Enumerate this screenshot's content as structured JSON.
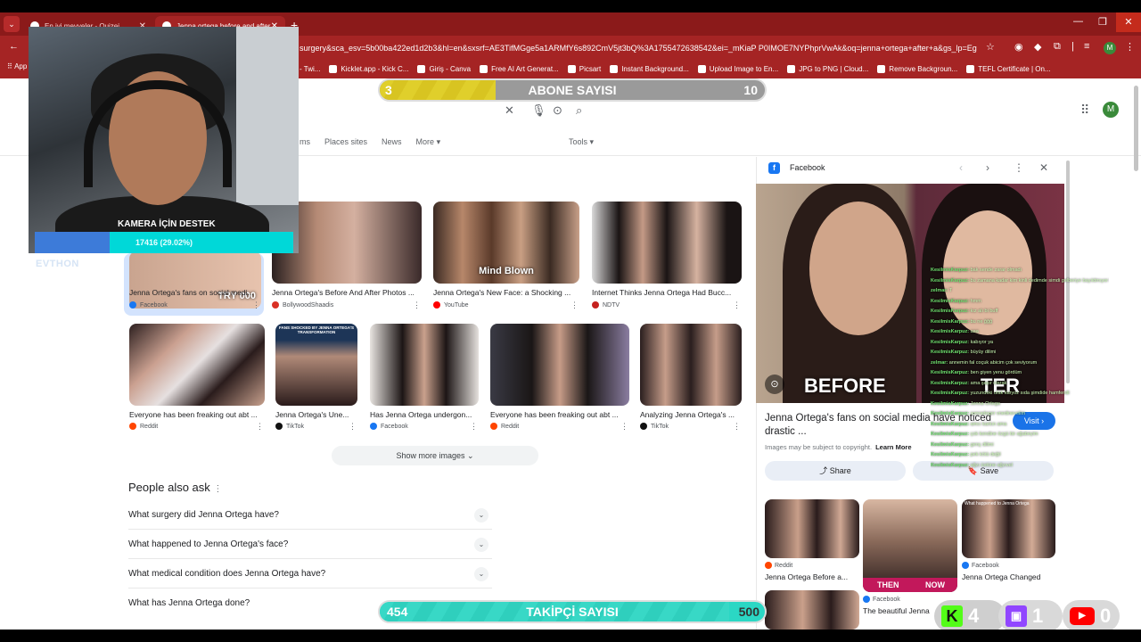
{
  "browser": {
    "tabs": [
      {
        "title": "En iyi meyveler - Quizei",
        "active": false
      },
      {
        "title": "Jenna ortega before and after s",
        "active": true
      }
    ],
    "url": "surgery&sca_esv=5b00ba422ed1d2b3&hl=en&sxsrf=AE3TifMGge5a1ARMfY6s892CmV5jt3bQ%3A1755472638542&ei=_mKiaP P0IMOE7NYPhprVwAk&oq=jenna+ortega+after+a&gs_lp=Egxnd...",
    "profile_initial": "M",
    "bookmarks_prefix": "App",
    "bookmarks": [
      "- Twi...",
      "Kicklet.app - Kick C...",
      "Giriş - Canva",
      "Free AI Art Generat...",
      "Picsart",
      "Instant Background...",
      "Upload Image to En...",
      "JPG to PNG | Cloud...",
      "Remove Backgroun...",
      "TEFL Certificate | On..."
    ]
  },
  "webcam": {
    "label": "KAMERA İÇİN DESTEK",
    "progress_text": "17416 (29.02%)",
    "progress_fraction": 0.29,
    "subtext": "EVTHON"
  },
  "subs_bar": {
    "left": "3",
    "title": "ABONE SAYISI",
    "right": "10",
    "fraction": 0.3
  },
  "follow_bar": {
    "left": "454",
    "title": "TAKİPÇİ SAYISI",
    "right": "500",
    "fraction": 0.908
  },
  "search": {
    "filters": [
      "ms",
      "Places sites",
      "News",
      "More"
    ],
    "tools": "Tools"
  },
  "images_row1": [
    {
      "caption": "Jenna Ortega's fans on social medi...",
      "source": "Facebook",
      "overlay": "TRY 000",
      "color": "#1877f2"
    },
    {
      "caption": "Jenna Ortega's Before And After Photos ...",
      "source": "BollywoodShaadis",
      "color": "#d93025"
    },
    {
      "caption": "Jenna Ortega's New Face: a Shocking ...",
      "source": "YouTube",
      "overlay": "Mind Blown",
      "color": "#ff0000"
    },
    {
      "caption": "Internet Thinks Jenna Ortega Had Bucc...",
      "source": "NDTV",
      "color": "#c5221f"
    }
  ],
  "images_row2": [
    {
      "caption": "Everyone has been freaking out abt ...",
      "source": "Reddit",
      "color": "#ff4500"
    },
    {
      "caption": "Jenna Ortega's Une...",
      "source": "TikTok",
      "overlay": "FANS SHOCKED BY JENNA ORTEGA'S TRANSFORMATION",
      "color": "#111111"
    },
    {
      "caption": "Has Jenna Ortega undergon...",
      "source": "Facebook",
      "color": "#1877f2"
    },
    {
      "caption": "Everyone has been freaking out abt ...",
      "source": "Reddit",
      "color": "#ff4500"
    },
    {
      "caption": "Analyzing Jenna Ortega's ...",
      "source": "TikTok",
      "color": "#111111"
    }
  ],
  "show_more": "Show more images",
  "paa": {
    "title": "People also ask",
    "questions": [
      "What surgery did Jenna Ortega have?",
      "What happened to Jenna Ortega's face?",
      "What medical condition does Jenna Ortega have?",
      "What has Jenna Ortega done?"
    ]
  },
  "panel": {
    "source": "Facebook",
    "hero_label_left": "BEFORE",
    "hero_label_right": "TER",
    "title": "Jenna Ortega's fans on social media have noticed drastic ...",
    "visit": "Visit",
    "copyright": "Images may be subject to copyright.",
    "learn_more": "Learn More",
    "share": "Share",
    "save": "Save",
    "related": [
      {
        "source": "Reddit",
        "caption": "Jenna Ortega Before a...",
        "color": "#ff4500"
      },
      {
        "source": "",
        "caption": "",
        "then": "THEN",
        "now": "NOW",
        "color": "#888888"
      },
      {
        "source": "Facebook",
        "caption": "Jenna Ortega Changed",
        "overlay": "What happened to Jenna Ortega",
        "color": "#1877f2"
      }
    ],
    "related_row2": {
      "source": "Facebook",
      "caption": "The beautiful Jenna"
    }
  },
  "chat": [
    {
      "user": "KesilmisKarpuz:",
      "msg": "bak sende zarar olmadı"
    },
    {
      "user": "KesilmisKarpuz:",
      "msg": "bu zamana kadar kim kinli dedimde simdi gelberiye bayıldmıyor tabbata vardır"
    },
    {
      "user": "zelmar:",
      "msg": "T"
    },
    {
      "user": "KesilmisKarpuz:",
      "msg": "hmm"
    },
    {
      "user": "KesilmisKarpuz:",
      "msg": "kız alı bi buff"
    },
    {
      "user": "KesilmisKarpuz:",
      "msg": "bu ne ğğğ"
    },
    {
      "user": "KesilmisKarpuz:",
      "msg": "aaa"
    },
    {
      "user": "KesilmisKarpuz:",
      "msg": "kabıyor ya"
    },
    {
      "user": "KesilmisKarpuz:",
      "msg": "büyüy dilimi"
    },
    {
      "user": "zelmar:",
      "msg": "annemin fal coçuk abicim çok seviyorum"
    },
    {
      "user": "KesilmisKarpuz:",
      "msg": "ben giyen yenu gördüm"
    },
    {
      "user": "KesilmisKarpuz:",
      "msg": "ama şaşır olarak"
    },
    {
      "user": "KesilmisKarpuz:",
      "msg": "yuzundeki ufak karyoz sıda şimdide hamfendi"
    },
    {
      "user": "KesilmisKarpuz:",
      "msg": "Jenna Ortega"
    },
    {
      "user": "KesilmisKarpuz:",
      "msg": "sonradeger vnedinevelim"
    },
    {
      "user": "KesilmisKarpuz:",
      "msg": "amcı karkın ama"
    },
    {
      "user": "KesilmisKarpuz:",
      "msg": "çok kendine özgü bir ağabeyim"
    },
    {
      "user": "KesilmisKarpuz:",
      "msg": "genç dilimi"
    },
    {
      "user": "KesilmisKarpuz:",
      "msg": "pek kötü değil"
    },
    {
      "user": "KesilmisKarpuz:",
      "msg": "ağzı üstüne ağzıvel"
    }
  ],
  "social": {
    "kick": "4",
    "twitch": "1",
    "youtube": "0"
  }
}
